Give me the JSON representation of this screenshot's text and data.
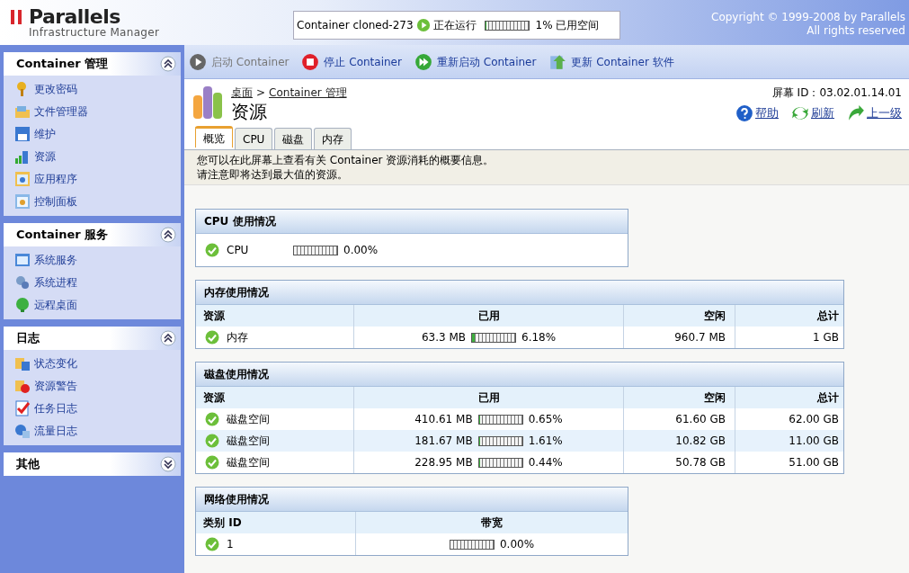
{
  "header": {
    "brand": "Parallels",
    "product": "Infrastructure Manager",
    "container": {
      "name": "Container cloned-273",
      "status": "正在运行",
      "level": 0.01,
      "usage": "1% 已用空间"
    },
    "copyright": [
      "Copyright © 1999-2008 by Parallels",
      "All rights reserved"
    ]
  },
  "toolbar": [
    {
      "label": "启动 Container",
      "kind": "start",
      "disabled": true
    },
    {
      "label": "停止 Container",
      "kind": "stop",
      "disabled": false
    },
    {
      "label": "重新启动 Container",
      "kind": "restart",
      "disabled": false
    },
    {
      "label": "更新 Container 软件",
      "kind": "update",
      "disabled": false
    }
  ],
  "sidebar": [
    {
      "title": "Container 管理",
      "expanded": true,
      "items": [
        "更改密码",
        "文件管理器",
        "维护",
        "资源",
        "应用程序",
        "控制面板"
      ]
    },
    {
      "title": "Container 服务",
      "expanded": true,
      "items": [
        "系统服务",
        "系统进程",
        "远程桌面"
      ]
    },
    {
      "title": "日志",
      "expanded": true,
      "items": [
        "状态变化",
        "资源警告",
        "任务日志",
        "流量日志"
      ]
    },
    {
      "title": "其他",
      "expanded": false
    }
  ],
  "breadcrumb": [
    "桌面",
    "Container 管理"
  ],
  "breadcrumb_separator": ">",
  "page_title": "资源",
  "screen_id": "屏幕 ID：03.02.01.14.01",
  "actions": [
    "帮助",
    "刷新",
    "上一级"
  ],
  "tabs": [
    {
      "label": "概览",
      "selected": true
    },
    {
      "label": "CPU",
      "selected": false
    },
    {
      "label": "磁盘",
      "selected": false
    },
    {
      "label": "内存",
      "selected": false
    }
  ],
  "info": [
    "您可以在此屏幕上查看有关 Container 资源消耗的概要信息。",
    "请注意即将达到最大值的资源。"
  ],
  "cpu": {
    "title": "CPU 使用情况",
    "rows": [
      {
        "name": "CPU",
        "level": 0.0,
        "percent": "0.00%"
      }
    ]
  },
  "memory": {
    "title": "内存使用情况",
    "columns": [
      "资源",
      "已用",
      "空闲",
      "总计"
    ],
    "rows": [
      {
        "name": "内存",
        "used": "63.3 MB",
        "level": 0.0618,
        "percent": "6.18%",
        "free": "960.7 MB",
        "total": "1 GB"
      }
    ]
  },
  "disk": {
    "title": "磁盘使用情况",
    "columns": [
      "资源",
      "已用",
      "空闲",
      "总计"
    ],
    "rows": [
      {
        "name": "磁盘空间",
        "used": "410.61 MB",
        "level": 0.0065,
        "percent": "0.65%",
        "free": "61.60 GB",
        "total": "62.00 GB"
      },
      {
        "name": "磁盘空间",
        "used": "181.67 MB",
        "level": 0.0161,
        "percent": "1.61%",
        "free": "10.82 GB",
        "total": "11.00 GB"
      },
      {
        "name": "磁盘空间",
        "used": "228.95 MB",
        "level": 0.0044,
        "percent": "0.44%",
        "free": "50.78 GB",
        "total": "51.00 GB"
      }
    ]
  },
  "network": {
    "title": "网络使用情况",
    "columns": [
      "类别 ID",
      "带宽"
    ],
    "rows": [
      {
        "name": "1",
        "level": 0.0,
        "percent": "0.00%"
      }
    ]
  }
}
